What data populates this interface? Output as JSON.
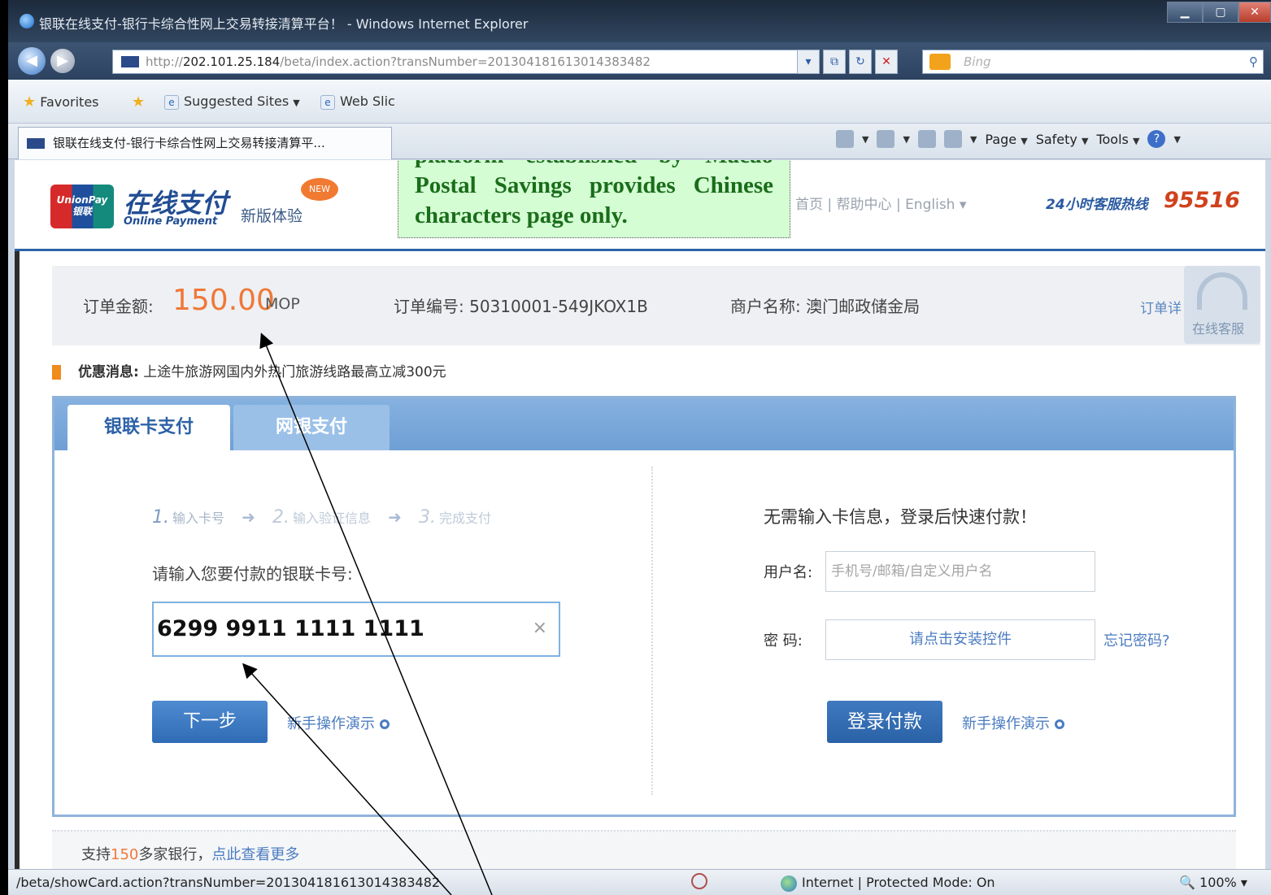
{
  "browser": {
    "title": "银联在线支付-银行卡综合性网上交易转接清算平台！ - Windows Internet Explorer",
    "address_prefix": "http://",
    "address_host": "202.101.25.184",
    "address_path": "/beta/index.action?transNumber=20130418161301438348​2",
    "search_placeholder": "Bing",
    "favorites_label": "Favorites",
    "suggested_sites": "Suggested Sites",
    "web_slice": "Web Slic",
    "tab_title": "银联在线支付-银行卡综合性网上交易转接清算平...",
    "cmd_page": "Page",
    "cmd_safety": "Safety",
    "cmd_tools": "Tools"
  },
  "header": {
    "logo_text": "UnionPay 银联",
    "brand_cn": "在线支付",
    "brand_en": "Online Payment",
    "new_version": "新版体验",
    "new_badge": "NEW",
    "links": "首页 | 帮助中心  |  English  ▾",
    "hotline_label": "24小时客服热线",
    "hotline_number": "95516"
  },
  "callout": {
    "text": "Electronic on-line payment platform established by Macao Postal Savings provides Chinese characters page only."
  },
  "order": {
    "amount_label": "订单金额:",
    "amount": "150.00",
    "currency": "MOP",
    "order_no": "订单编号: 50310001-549JKOX1B",
    "merchant": "商户名称: 澳门邮政储金局",
    "detail_link": "订单详",
    "cs_label": "在线客服"
  },
  "promo": {
    "label": "优惠消息:",
    "text": "上途牛旅游网国内外热门旅游线路最高立减300元"
  },
  "tabs": {
    "card": "银联卡支付",
    "netbank": "网银支付"
  },
  "card_pay": {
    "step1_num": "1.",
    "step1": "输入卡号",
    "step2_num": "2.",
    "step2": "输入验证信息",
    "step3_num": "3.",
    "step3": "完成支付",
    "prompt": "请输入您要付款的银联卡号:",
    "card_number": "6299 9911 1111 1111",
    "clear": "×",
    "next_button": "下一步",
    "demo_link": "新手操作演示"
  },
  "login_pay": {
    "heading": "无需输入卡信息，登录后快速付款！",
    "username_label": "用户名:",
    "username_placeholder": "手机号/邮箱/自定义用户名",
    "password_label": "密  码:",
    "password_placeholder": "请点击安装控件",
    "forgot": "忘记密码?",
    "login_button": "登录付款",
    "demo_link": "新手操作演示"
  },
  "banks": {
    "prefix": "支持",
    "count": "150",
    "suffix": "多家银行，",
    "more": "点此查看更多"
  },
  "statusbar": {
    "url": "/beta/showCard.action?transNumber=20130418161301438348​2",
    "zone": "Internet | Protected Mode: On",
    "zoom": "100%"
  }
}
